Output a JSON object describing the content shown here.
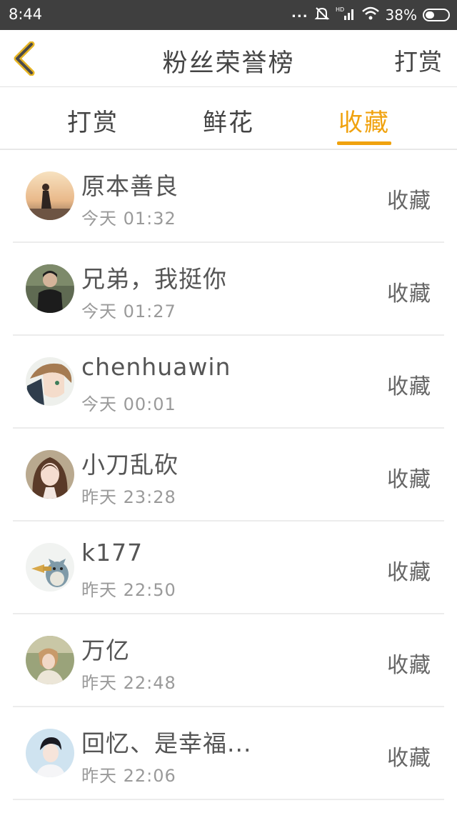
{
  "status_bar": {
    "time": "8:44",
    "dots": "...",
    "battery_percent": "38%"
  },
  "header": {
    "title": "粉丝荣誉榜",
    "right_action": "打赏"
  },
  "tabs": [
    {
      "label": "打赏",
      "active": false
    },
    {
      "label": "鲜花",
      "active": false
    },
    {
      "label": "收藏",
      "active": true
    }
  ],
  "colors": {
    "accent": "#f0a20e",
    "status_bar": "#3f3f3f",
    "text": "#444444",
    "subtext": "#9a9a9a"
  },
  "fans": [
    {
      "name": "原本善良",
      "time": "今天 01:32",
      "action": "收藏",
      "avatar": "sunset-silhouette-avatar"
    },
    {
      "name": "兄弟，我挺你",
      "time": "今天 01:27",
      "action": "收藏",
      "avatar": "man-portrait-avatar"
    },
    {
      "name": "chenhuawin",
      "time": "今天 00:01",
      "action": "收藏",
      "avatar": "anime-character-avatar"
    },
    {
      "name": "小刀乱砍",
      "time": "昨天 23:28",
      "action": "收藏",
      "avatar": "woman-portrait-avatar"
    },
    {
      "name": "k177",
      "time": "昨天 22:50",
      "action": "收藏",
      "avatar": "totoro-avatar"
    },
    {
      "name": "万亿",
      "time": "昨天 22:48",
      "action": "收藏",
      "avatar": "outdoor-woman-avatar"
    },
    {
      "name": "回忆、是幸福...",
      "time": "昨天 22:06",
      "action": "收藏",
      "avatar": "boy-portrait-avatar"
    }
  ]
}
